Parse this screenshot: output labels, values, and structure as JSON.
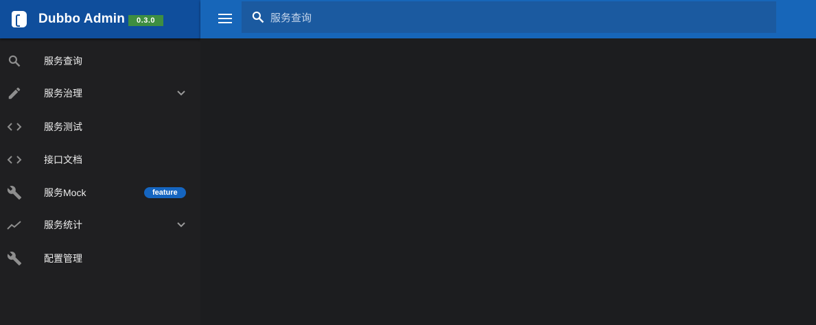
{
  "brand": {
    "title": "Dubbo Admin",
    "version": "0.3.0"
  },
  "search": {
    "placeholder": "服务查询",
    "value": ""
  },
  "menu": [
    {
      "label": "服务查询",
      "icon": "search-icon"
    },
    {
      "label": "服务治理",
      "icon": "pencil-icon",
      "expandable": true
    },
    {
      "label": "服务测试",
      "icon": "code-icon"
    },
    {
      "label": "接口文档",
      "icon": "code-icon"
    },
    {
      "label": "服务Mock",
      "icon": "wrench-icon",
      "badge": "feature"
    },
    {
      "label": "服务统计",
      "icon": "trending-up-icon",
      "expandable": true
    },
    {
      "label": "配置管理",
      "icon": "wrench-icon"
    }
  ],
  "colors": {
    "header_brand": "#0f4e9c",
    "toolbar": "#1766b9",
    "version_badge": "#3e8e41",
    "feature_badge": "#1565c0"
  }
}
